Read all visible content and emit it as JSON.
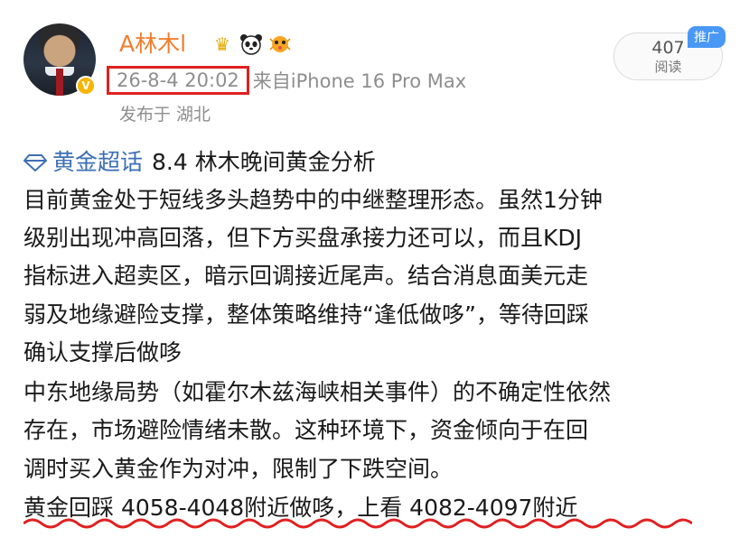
{
  "user": {
    "name": "A林木l",
    "badges": [
      "crown-badge-icon",
      "panda-badge-icon",
      "pufferfish-badge-icon"
    ],
    "verified_icon": "verified-v-icon"
  },
  "post_meta": {
    "timestamp": "26-8-4 20:02",
    "source": "来自iPhone 16 Pro Max",
    "location": "发布于 湖北"
  },
  "stats": {
    "views": "407",
    "views_label": "阅读",
    "promo_tag": "推广"
  },
  "content": {
    "topic_icon": "diamond-topic-icon",
    "topic_link": "黄金超话",
    "title": "8.4 林木晚间黄金分析",
    "lines": [
      "目前黄金处于短线多头趋势中的中继整理形态。虽然1分钟",
      "级别出现冲高回落，但下方买盘承接力还可以，而且KDJ",
      "指标进入超卖区，暗示回调接近尾声。结合消息面美元走",
      "弱及地缘避险支撑，整体策略维持“逢低做哆”，等待回踩",
      "确认支撑后做哆",
      "中东地缘局势（如霍尔木兹海峡相关事件）的不确定性依然",
      "存在，市场避险情绪未散。这种环境下，资金倾向于在回",
      "调时买入黄金作为对冲，限制了下跌空间。",
      "黄金回踩 4058-4048附近做哆，上看 4082-4097附近"
    ]
  },
  "colors": {
    "username": "#f27d2c",
    "link": "#3c6fb5",
    "highlight_box": "#e02020",
    "underline": "#e02020",
    "promo": "#4a98f6"
  }
}
